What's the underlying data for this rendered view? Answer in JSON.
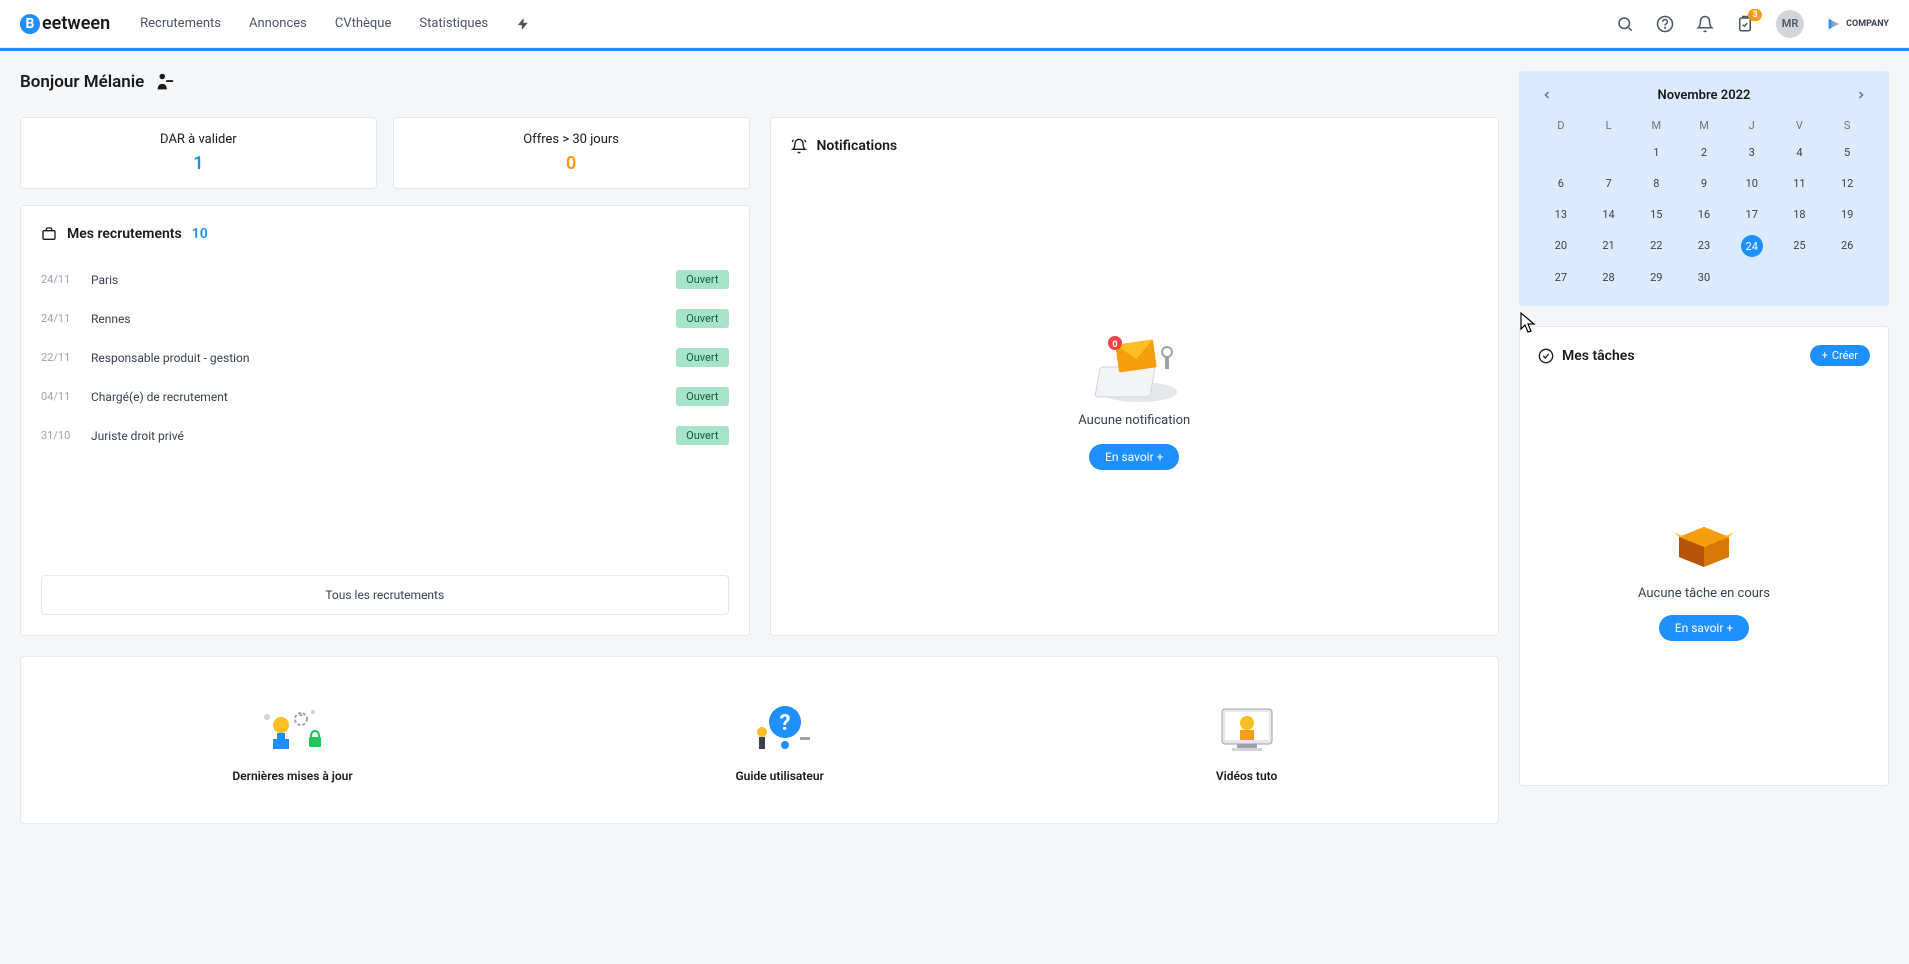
{
  "header": {
    "logo_text": "eetween",
    "logo_letter": "B",
    "nav": [
      "Recrutements",
      "Annonces",
      "CVthèque",
      "Statistiques"
    ],
    "badge_count": "3",
    "avatar_initials": "MR",
    "company": "COMPANY"
  },
  "greeting": "Bonjour Mélanie",
  "stats": {
    "dar": {
      "label": "DAR à valider",
      "value": "1"
    },
    "offers": {
      "label": "Offres > 30 jours",
      "value": "0"
    }
  },
  "recruitments": {
    "title": "Mes recrutements",
    "count": "10",
    "items": [
      {
        "date": "24/11",
        "title": "Paris",
        "status": "Ouvert"
      },
      {
        "date": "24/11",
        "title": "Rennes",
        "status": "Ouvert"
      },
      {
        "date": "22/11",
        "title": "Responsable produit - gestion",
        "status": "Ouvert"
      },
      {
        "date": "04/11",
        "title": "Chargé(e) de recrutement",
        "status": "Ouvert"
      },
      {
        "date": "31/10",
        "title": "Juriste droit privé",
        "status": "Ouvert"
      }
    ],
    "all_link": "Tous les recrutements"
  },
  "notifications": {
    "title": "Notifications",
    "empty_text": "Aucune notification",
    "button": "En savoir +"
  },
  "bottom": {
    "items": [
      {
        "label": "Dernières mises à jour"
      },
      {
        "label": "Guide utilisateur"
      },
      {
        "label": "Vidéos tuto"
      }
    ]
  },
  "calendar": {
    "month": "Novembre 2022",
    "dow": [
      "D",
      "L",
      "M",
      "M",
      "J",
      "V",
      "S"
    ],
    "weeks": [
      [
        "",
        "",
        "1",
        "2",
        "3",
        "4",
        "5"
      ],
      [
        "6",
        "7",
        "8",
        "9",
        "10",
        "11",
        "12"
      ],
      [
        "13",
        "14",
        "15",
        "16",
        "17",
        "18",
        "19"
      ],
      [
        "20",
        "21",
        "22",
        "23",
        "24",
        "25",
        "26"
      ],
      [
        "27",
        "28",
        "29",
        "30",
        "",
        "",
        ""
      ]
    ],
    "today": "24"
  },
  "tasks": {
    "title": "Mes tâches",
    "create_button": "Créer",
    "empty_text": "Aucune tâche en cours",
    "button": "En savoir +"
  }
}
